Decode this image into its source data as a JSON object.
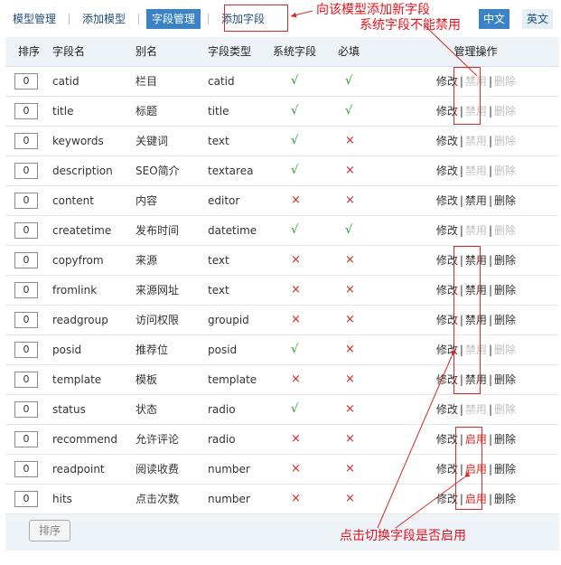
{
  "toolbar": {
    "model_manage": "模型管理",
    "add_model": "添加模型",
    "field_manage": "字段管理",
    "add_field": "添加字段"
  },
  "lang": {
    "zh": "中文",
    "en": "英文"
  },
  "headers": {
    "order": "排序",
    "field": "字段名",
    "alias": "别名",
    "type": "字段类型",
    "system": "系统字段",
    "required": "必填",
    "ops": "管理操作"
  },
  "rows": [
    {
      "order": "0",
      "field": "catid",
      "alias": "栏目",
      "type": "catid",
      "system": "√",
      "required": "√",
      "toggle": "禁用"
    },
    {
      "order": "0",
      "field": "title",
      "alias": "标题",
      "type": "title",
      "system": "√",
      "required": "√",
      "toggle": "禁用"
    },
    {
      "order": "0",
      "field": "keywords",
      "alias": "关键词",
      "type": "text",
      "system": "√",
      "required": "×",
      "toggle": "禁用"
    },
    {
      "order": "0",
      "field": "description",
      "alias": "SEO简介",
      "type": "textarea",
      "system": "√",
      "required": "×",
      "toggle": "禁用"
    },
    {
      "order": "0",
      "field": "content",
      "alias": "内容",
      "type": "editor",
      "system": "×",
      "required": "×",
      "toggle": "禁用"
    },
    {
      "order": "0",
      "field": "createtime",
      "alias": "发布时间",
      "type": "datetime",
      "system": "√",
      "required": "√",
      "toggle": "禁用"
    },
    {
      "order": "0",
      "field": "copyfrom",
      "alias": "来源",
      "type": "text",
      "system": "×",
      "required": "×",
      "toggle": "禁用"
    },
    {
      "order": "0",
      "field": "fromlink",
      "alias": "来源网址",
      "type": "text",
      "system": "×",
      "required": "×",
      "toggle": "禁用"
    },
    {
      "order": "0",
      "field": "readgroup",
      "alias": "访问权限",
      "type": "groupid",
      "system": "×",
      "required": "×",
      "toggle": "禁用"
    },
    {
      "order": "0",
      "field": "posid",
      "alias": "推荐位",
      "type": "posid",
      "system": "√",
      "required": "×",
      "toggle": "禁用"
    },
    {
      "order": "0",
      "field": "template",
      "alias": "模板",
      "type": "template",
      "system": "×",
      "required": "×",
      "toggle": "禁用"
    },
    {
      "order": "0",
      "field": "status",
      "alias": "状态",
      "type": "radio",
      "system": "√",
      "required": "×",
      "toggle": "禁用"
    },
    {
      "order": "0",
      "field": "recommend",
      "alias": "允许评论",
      "type": "radio",
      "system": "×",
      "required": "×",
      "toggle": "启用"
    },
    {
      "order": "0",
      "field": "readpoint",
      "alias": "阅读收费",
      "type": "number",
      "system": "×",
      "required": "×",
      "toggle": "启用"
    },
    {
      "order": "0",
      "field": "hits",
      "alias": "点击次数",
      "type": "number",
      "system": "×",
      "required": "×",
      "toggle": "启用"
    }
  ],
  "op_labels": {
    "edit": "修改",
    "delete": "删除",
    "sep": "|"
  },
  "footer": {
    "sort_button": "排序"
  },
  "annotations": {
    "add_field_note": "向该模型添加新字段",
    "system_field_note": "系统字段不能禁用",
    "toggle_note": "点击切换字段是否启用"
  },
  "colors": {
    "accent": "#3b83c5",
    "check": "#1e9a1e",
    "cross": "#d9251d",
    "annotation": "#e0141e"
  }
}
